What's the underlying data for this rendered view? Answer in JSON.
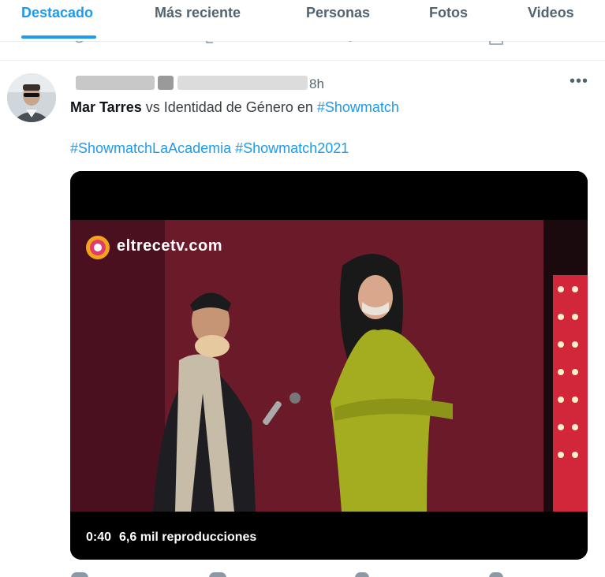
{
  "tabs": [
    {
      "label": "Destacado",
      "active": true
    },
    {
      "label": "Más reciente",
      "active": false
    },
    {
      "label": "Personas",
      "active": false
    },
    {
      "label": "Fotos",
      "active": false
    },
    {
      "label": "Videos",
      "active": false
    }
  ],
  "colors": {
    "accent": "#1d9bf0",
    "text": "#0f1419",
    "muted": "#536471",
    "dress": "#a3ad1f",
    "backdrop": "#6b1a2a"
  },
  "tweet": {
    "time": "8h",
    "more_icon": "more-horizontal-icon",
    "author_name": "Mar Tarres",
    "text_rest": " vs Identidad de Género en ",
    "hashtag_1": "#Showmatch",
    "hashtag_2": "#ShowmatchLaAcademia",
    "hashtag_3": "#Showmatch2021"
  },
  "video": {
    "watermark": "eltrecetv.com",
    "duration": "0:40",
    "views": "6,6 mil reproducciones"
  }
}
